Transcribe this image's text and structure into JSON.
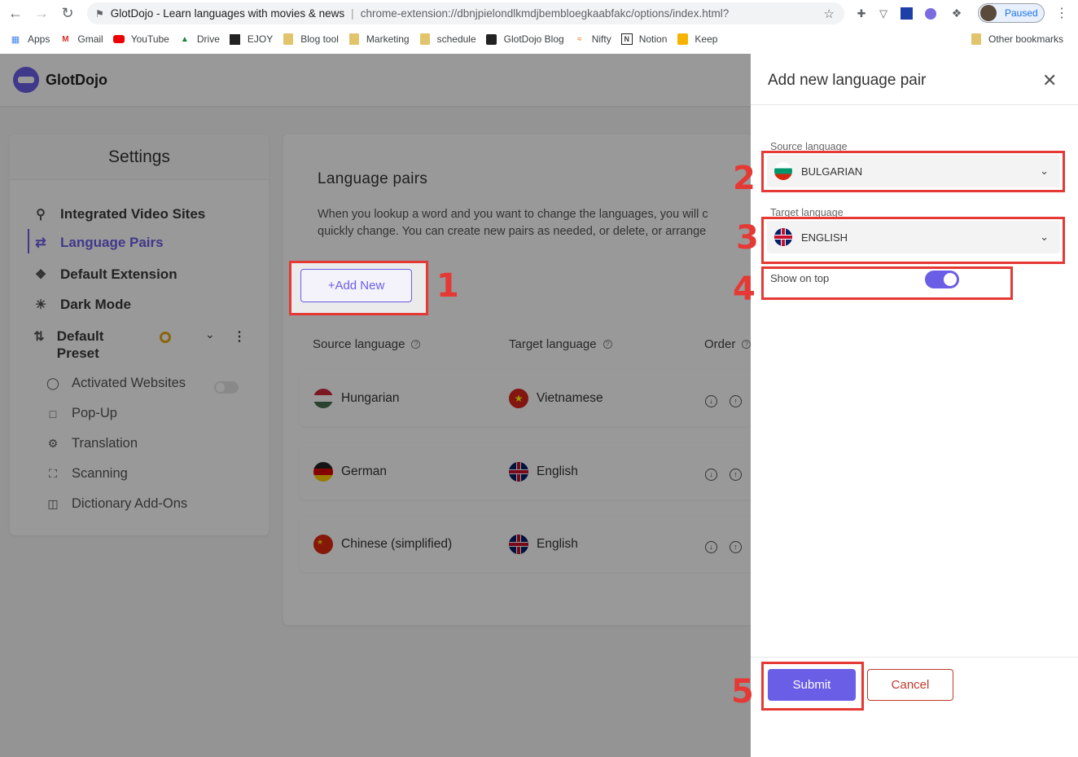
{
  "browser": {
    "tab_title": "GlotDojo - Learn languages with movies & news",
    "url": "chrome-extension://dbnjpielondlkmdjbembloegkaabfakc/options/index.html?",
    "profile_status": "Paused"
  },
  "bookmarks": [
    "Apps",
    "Gmail",
    "YouTube",
    "Drive",
    "EJOY",
    "Blog tool",
    "Marketing",
    "schedule",
    "GlotDojo Blog",
    "Nifty",
    "Notion",
    "Keep"
  ],
  "other_bookmarks": "Other bookmarks",
  "app": {
    "logo_text": "GlotDojo"
  },
  "sidebar": {
    "title": "Settings",
    "items": [
      {
        "label": "Integrated Video Sites",
        "icon": "search-icon"
      },
      {
        "label": "Language Pairs",
        "icon": "language-pairs-icon",
        "active": true
      },
      {
        "label": "Default Extension",
        "icon": "puzzle-icon"
      },
      {
        "label": "Dark Mode",
        "icon": "sunrise-icon"
      },
      {
        "label": "Default Preset",
        "icon": "repeat-icon"
      }
    ],
    "sub_items": [
      {
        "label": "Activated Websites",
        "icon": "globe-icon"
      },
      {
        "label": "Pop-Up",
        "icon": "chat-icon"
      },
      {
        "label": "Translation",
        "icon": "translate-icon"
      },
      {
        "label": "Scanning",
        "icon": "scan-icon"
      },
      {
        "label": "Dictionary Add-Ons",
        "icon": "book-icon"
      }
    ]
  },
  "main": {
    "title": "Language pairs",
    "description_line1": "When you lookup a word and you want to change the languages, you will c",
    "description_line2": "quickly change. You can create new pairs as needed, or delete, or arrange",
    "add_button": "+Add New",
    "columns": [
      "Source language",
      "Target language",
      "Order"
    ],
    "pairs": [
      {
        "source": "Hungarian",
        "target": "Vietnamese"
      },
      {
        "source": "German",
        "target": "English"
      },
      {
        "source": "Chinese (simplified)",
        "target": "English"
      }
    ]
  },
  "panel": {
    "title": "Add new language pair",
    "source_label": "Source language",
    "source_value": "BULGARIAN",
    "target_label": "Target language",
    "target_value": "ENGLISH",
    "show_on_top_label": "Show on top",
    "show_on_top": true,
    "submit": "Submit",
    "cancel": "Cancel"
  },
  "annotations": [
    "1",
    "2",
    "3",
    "4",
    "5"
  ],
  "colors": {
    "accent": "#6b5ee6",
    "highlight": "#e53935",
    "cancel": "#c0392b"
  }
}
